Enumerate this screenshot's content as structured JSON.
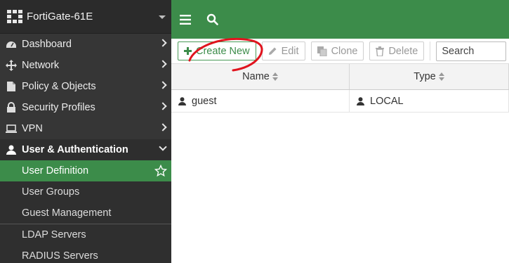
{
  "sidebar": {
    "device_name": "FortiGate-61E",
    "items": [
      {
        "label": "Dashboard",
        "icon": "dashboard-icon"
      },
      {
        "label": "Network",
        "icon": "network-move-icon"
      },
      {
        "label": "Policy & Objects",
        "icon": "policy-document-icon"
      },
      {
        "label": "Security Profiles",
        "icon": "lock-icon"
      },
      {
        "label": "VPN",
        "icon": "laptop-icon"
      },
      {
        "label": "User & Authentication",
        "icon": "user-icon"
      }
    ],
    "sub_items": [
      {
        "label": "User Definition",
        "active": true
      },
      {
        "label": "User Groups"
      },
      {
        "label": "Guest Management"
      },
      {
        "label": "LDAP Servers"
      },
      {
        "label": "RADIUS Servers"
      }
    ]
  },
  "topbar": {
    "icons": [
      "hamburger-menu-icon",
      "search-icon"
    ]
  },
  "toolbar": {
    "create_new": "Create New",
    "edit": "Edit",
    "clone": "Clone",
    "delete": "Delete",
    "search_placeholder": "Search"
  },
  "table": {
    "columns": [
      "Name",
      "Type"
    ],
    "rows": [
      {
        "name": "guest",
        "type": "LOCAL"
      }
    ]
  },
  "colors": {
    "accent_green": "#3c8c4a",
    "sidebar_bg": "#363636",
    "annotation_red": "#e0141e"
  }
}
